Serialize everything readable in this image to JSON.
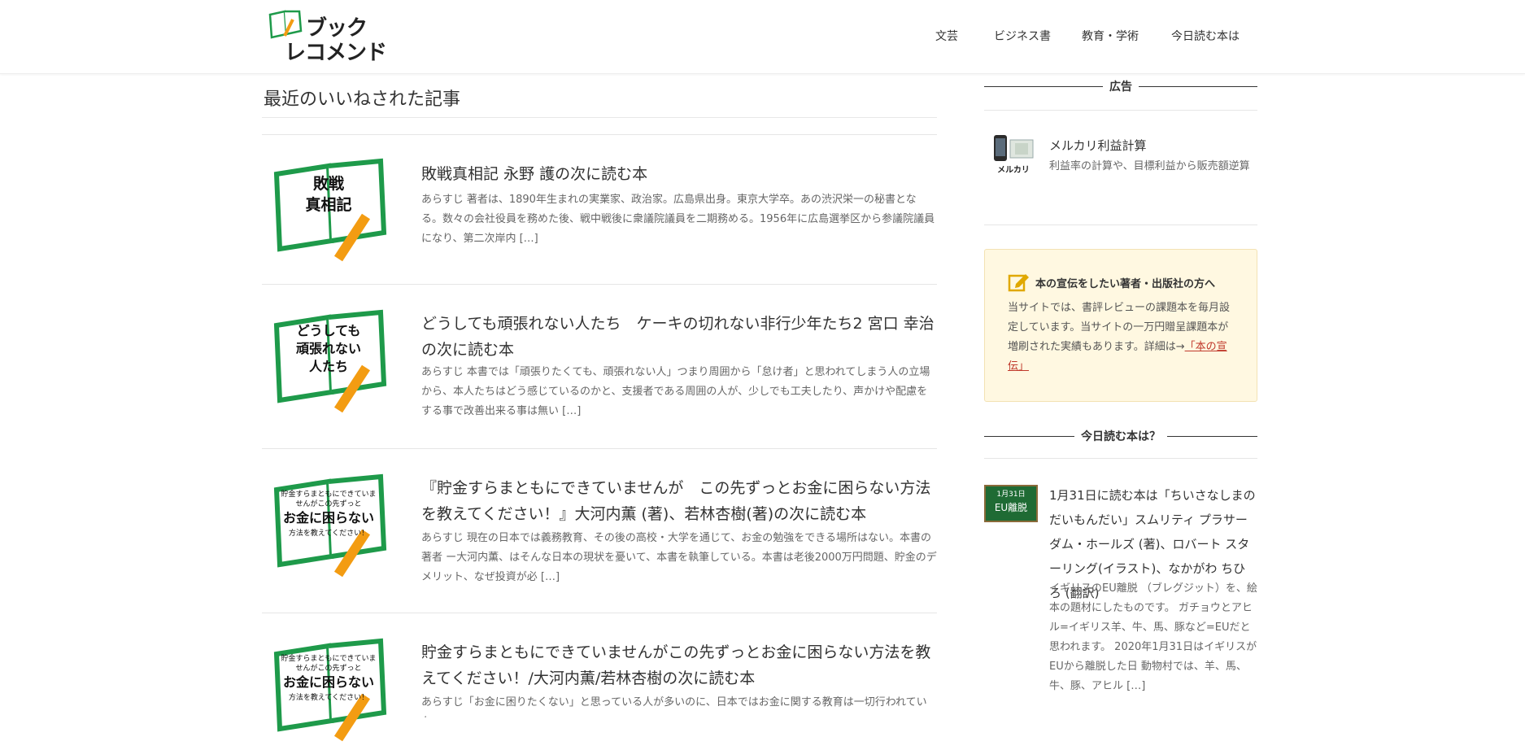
{
  "header": {
    "logo_line1": "ブック",
    "logo_line2": "レコメンド",
    "nav": [
      "文芸",
      "ビジネス書",
      "教育・学術",
      "今日読む本は"
    ]
  },
  "main": {
    "title": "最近のいいねされた記事",
    "articles": [
      {
        "thumb_text": [
          "敗戦",
          "真相記"
        ],
        "title": "敗戦真相記 永野 護の次に読む本",
        "excerpt": "あらすじ 著者は、1890年生まれの実業家、政治家。広島県出身。東京大学卒。あの渋沢栄一の秘書となる。数々の会社役員を務めた後、戦中戦後に衆議院議員を二期務める。1956年に広島選挙区から参議院議員になり、第二次岸内 […]"
      },
      {
        "thumb_text": [
          "どうしても",
          "頑張れない",
          "人たち"
        ],
        "title": "どうしても頑張れない人たち　ケーキの切れない非行少年たち2 宮口 幸治の次に読む本",
        "excerpt": "あらすじ 本書では「頑張りたくても、頑張れない人」つまり周囲から「怠け者」と思われてしまう人の立場から、本人たちはどう感じているのかと、支援者である周囲の人が、少しでも工夫したり、声かけや配慮をする事で改善出来る事は無い […]"
      },
      {
        "thumb_text": [
          "貯金すらまともにできていま",
          "せんがこの先ずっと",
          "お金に困らない",
          "方法を教えてください！"
        ],
        "title": "『貯金すらまともにできていませんが　この先ずっとお金に困らない方法を教えてください！』大河内薫 (著)、若林杏樹(著)の次に読む本",
        "excerpt": "あらすじ 現在の日本では義務教育、その後の高校・大学を通じて、お金の勉強をできる場所はない。本書の著者 ー大河内薫、はそんな日本の現状を憂いて、本書を執筆している。本書は老後2000万円問題、貯金のデメリット、なぜ投資が必 […]"
      },
      {
        "thumb_text": [
          "貯金すらまともにできていま",
          "せんがこの先ずっと",
          "お金に困らない",
          "方法を教えてください！"
        ],
        "title": "貯金すらまともにできていませんがこの先ずっとお金に困らない方法を教えてください！/大河内薫/若林杏樹の次に読む本",
        "excerpt": "あらすじ「お金に困りたくない」と思っている人が多いのに、日本ではお金に関する教育は一切行われていな"
      }
    ]
  },
  "sidebar": {
    "ad_heading": "広告",
    "ad_icon_label": "メルカリ",
    "ad_title": "メルカリ利益計算",
    "ad_text": "利益率の計算や、目標利益から販売額逆算",
    "promo_title": "本の宣伝をしたい著者・出版社の方へ",
    "promo_text": "当サイトでは、書評レビューの課題本を毎月設定しています。当サイトの一万円贈呈課題本が増刷された実績もあります。詳細は→",
    "promo_link": "「本の宣伝」",
    "today_heading": "今日読む本は？",
    "today_badge_date": "1月31日",
    "today_badge_label": "EU離脱",
    "today_title": "1月31日に読む本は「ちいさなしまのだいもんだい」スムリティ プラサーダム・ホールズ (著)、ロバート スターリング(イラスト)、なかがわ ちひろ (翻訳)",
    "today_text": "イギリスのEU離脱 （ブレグジット）を、絵本の題材にしたものです。 ガチョウとアヒル=イギリス羊、牛、馬、豚など=EUだと思われます。 2020年1月31日はイギリスがEUから離脱した日 動物村では、羊、馬、牛、豚、アヒル […]"
  },
  "colors": {
    "book_green": "#1e9a4a",
    "pencil_orange": "#f39c12",
    "promo_bg": "#fff8e1",
    "link_red": "#c0392b"
  }
}
